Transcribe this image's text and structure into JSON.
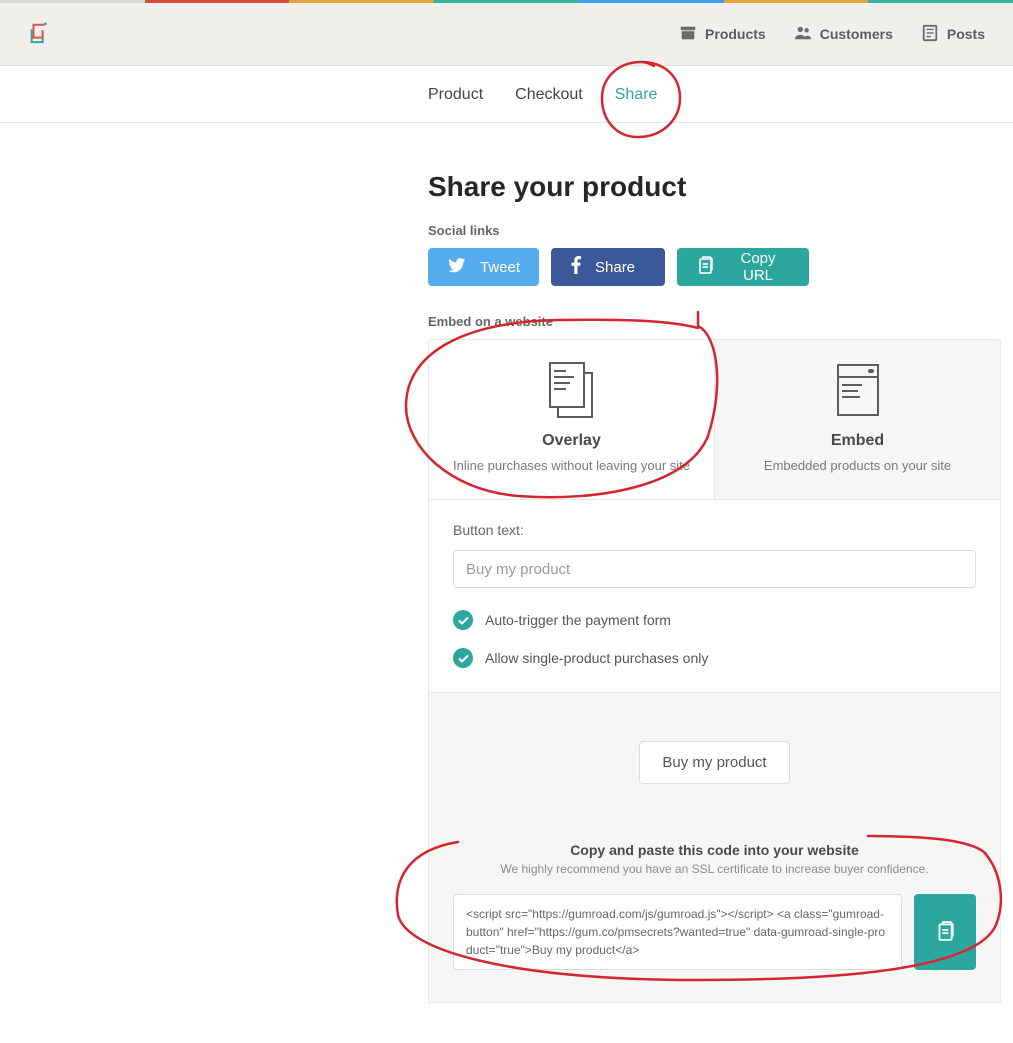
{
  "nav": {
    "products": "Products",
    "customers": "Customers",
    "posts": "Posts"
  },
  "subnav": {
    "product": "Product",
    "checkout": "Checkout",
    "share": "Share"
  },
  "page": {
    "title": "Share your product",
    "social_label": "Social links",
    "embed_label": "Embed on a website"
  },
  "social": {
    "tweet": "Tweet",
    "share": "Share",
    "copy_url": "Copy URL"
  },
  "embed_cards": {
    "overlay_title": "Overlay",
    "overlay_desc": "Inline purchases without leaving your site",
    "embed_title": "Embed",
    "embed_desc": "Embedded products on your site"
  },
  "form": {
    "button_text_label": "Button text:",
    "button_text_placeholder": "Buy my product",
    "auto_trigger": "Auto-trigger the payment form",
    "single_product": "Allow single-product purchases only"
  },
  "preview": {
    "button_label": "Buy my product",
    "copy_heading": "Copy and paste this code into your website",
    "copy_sub": "We highly recommend you have an SSL certificate to increase buyer confidence.",
    "code": "<script src=\"https://gumroad.com/js/gumroad.js\"></script>\n<a class=\"gumroad-button\" href=\"https://gum.co/pmsecrets?wanted=true\" data-gumroad-single-product=\"true\">Buy my product</a>"
  }
}
